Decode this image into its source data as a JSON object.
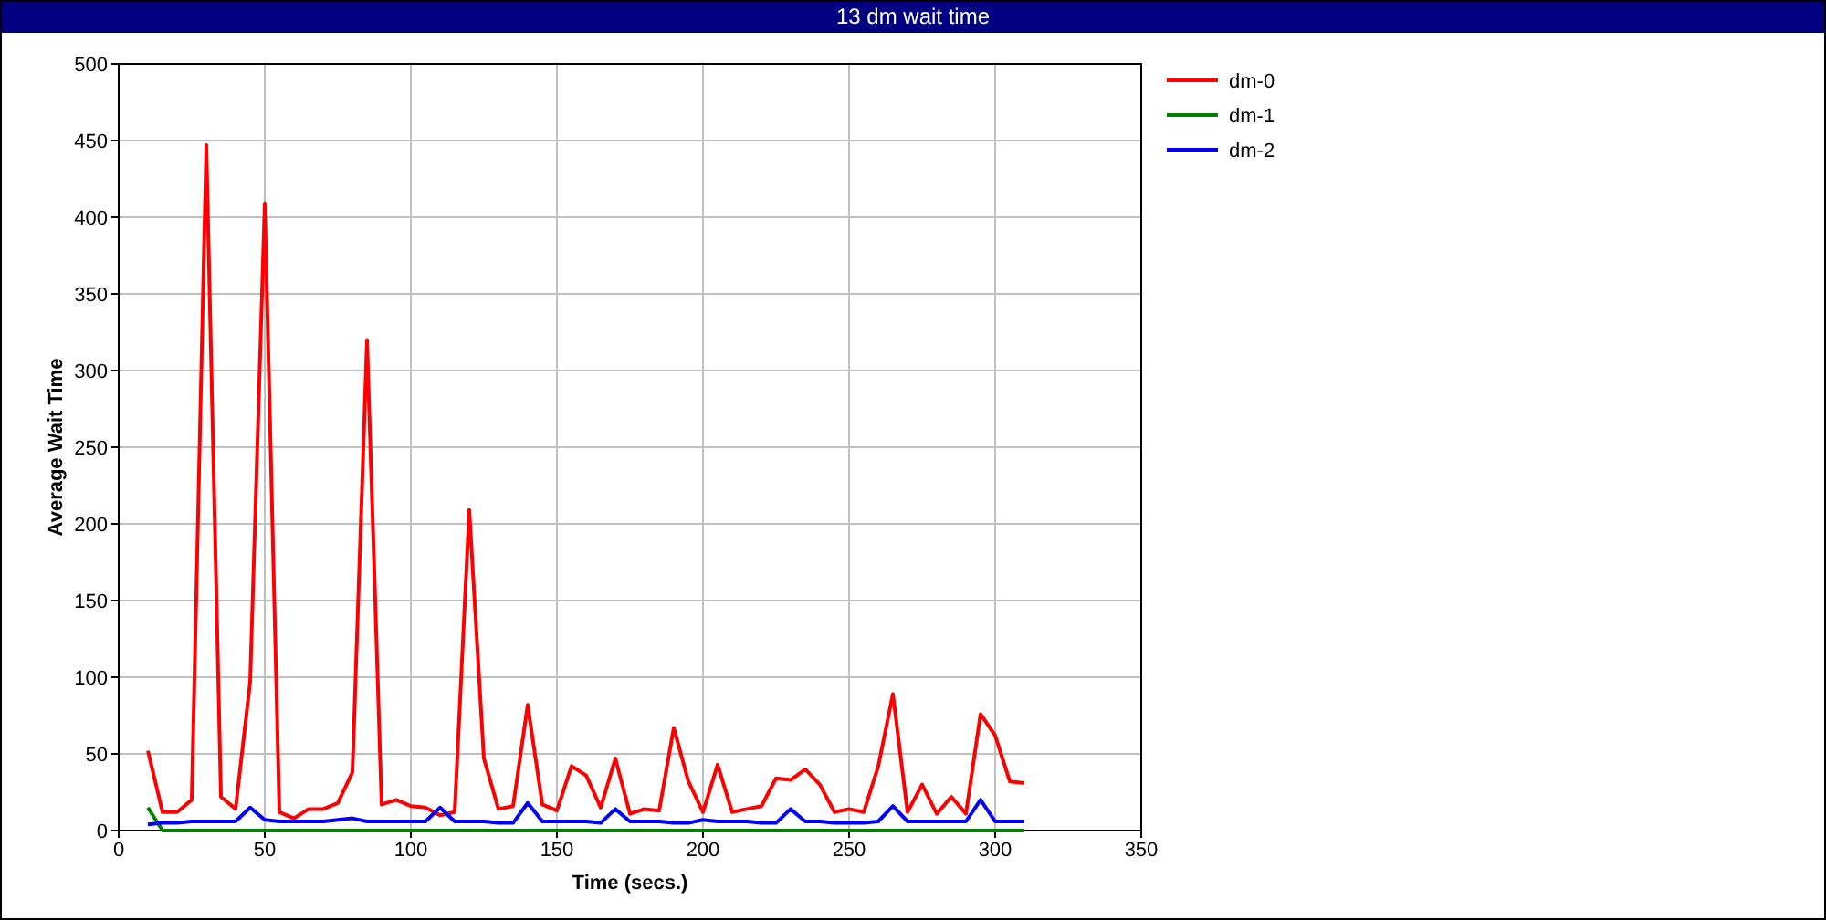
{
  "window": {
    "title": "13 dm wait time"
  },
  "chart_data": {
    "type": "line",
    "grid": true,
    "legend": true,
    "xlabel": "Time (secs.)",
    "ylabel": "Average Wait Time",
    "xlim": [
      0,
      350
    ],
    "ylim": [
      0,
      500
    ],
    "xticks": [
      0,
      50,
      100,
      150,
      200,
      250,
      300,
      350
    ],
    "yticks": [
      0,
      50,
      100,
      150,
      200,
      250,
      300,
      350,
      400,
      450,
      500
    ],
    "x": [
      10,
      15,
      20,
      25,
      30,
      35,
      40,
      45,
      50,
      55,
      60,
      65,
      70,
      75,
      80,
      85,
      90,
      95,
      100,
      105,
      110,
      115,
      120,
      125,
      130,
      135,
      140,
      145,
      150,
      155,
      160,
      165,
      170,
      175,
      180,
      185,
      190,
      195,
      200,
      205,
      210,
      215,
      220,
      225,
      230,
      235,
      240,
      245,
      250,
      255,
      260,
      265,
      270,
      275,
      280,
      285,
      290,
      295,
      300,
      305,
      310
    ],
    "series": [
      {
        "name": "dm-0",
        "color": "#ff0000",
        "values": [
          52,
          12,
          12,
          20,
          447,
          22,
          14,
          97,
          409,
          12,
          8,
          14,
          14,
          18,
          38,
          320,
          17,
          20,
          16,
          15,
          10,
          12,
          209,
          47,
          14,
          16,
          82,
          17,
          13,
          42,
          36,
          15,
          47,
          11,
          14,
          13,
          67,
          32,
          12,
          43,
          12,
          14,
          16,
          34,
          33,
          40,
          30,
          12,
          14,
          12,
          42,
          89,
          12,
          30,
          11,
          22,
          11,
          76,
          62,
          32,
          31
        ]
      },
      {
        "name": "dm-1",
        "color": "#008000",
        "values": [
          15,
          0,
          0,
          0,
          0,
          0,
          0,
          0,
          0,
          0,
          0,
          0,
          0,
          0,
          0,
          0,
          0,
          0,
          0,
          0,
          0,
          0,
          0,
          0,
          0,
          0,
          0,
          0,
          0,
          0,
          0,
          0,
          0,
          0,
          0,
          0,
          0,
          0,
          0,
          0,
          0,
          0,
          0,
          0,
          0,
          0,
          0,
          0,
          0,
          0,
          0,
          0,
          0,
          0,
          0,
          0,
          0,
          0,
          0,
          0,
          0
        ]
      },
      {
        "name": "dm-2",
        "color": "#0000ff",
        "values": [
          4,
          5,
          5,
          6,
          6,
          6,
          6,
          15,
          7,
          6,
          6,
          6,
          6,
          7,
          8,
          6,
          6,
          6,
          6,
          6,
          15,
          6,
          6,
          6,
          5,
          5,
          18,
          6,
          6,
          6,
          6,
          5,
          14,
          6,
          6,
          6,
          5,
          5,
          7,
          6,
          6,
          6,
          5,
          5,
          14,
          6,
          6,
          5,
          5,
          5,
          6,
          16,
          6,
          6,
          6,
          6,
          6,
          20,
          6,
          6,
          6
        ]
      }
    ]
  }
}
